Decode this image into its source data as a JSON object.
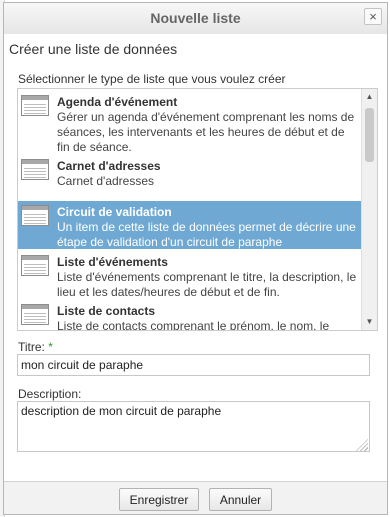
{
  "dialog": {
    "title": "Nouvelle liste",
    "close_label": "×"
  },
  "content": {
    "heading": "Créer une liste de données",
    "select_label": "Sélectionner le type de liste que vous voulez créer"
  },
  "list_types": [
    {
      "title": "Agenda d'événement",
      "description": "Gérer un agenda d'événement comprenant les noms de séances, les intervenants et les heures de début et de fin de séance.",
      "selected": false
    },
    {
      "title": "Carnet d'adresses",
      "description": "Carnet d'adresses",
      "selected": false
    },
    {
      "title": "Circuit de validation",
      "description": "Un item de cette liste de données permet de décrire une étape de validation d'un circuit de paraphe",
      "selected": true
    },
    {
      "title": "Liste d'événements",
      "description": "Liste d'événements comprenant le titre, la description, le lieu et les dates/heures de début et de fin.",
      "selected": false
    },
    {
      "title": "Liste de contacts",
      "description": "Liste de contacts comprenant le prénom, le nom, le",
      "selected": false
    }
  ],
  "form": {
    "title_label": "Titre:",
    "required_marker": "*",
    "title_value": "mon circuit de paraphe",
    "description_label": "Description:",
    "description_value": "description de mon circuit de paraphe"
  },
  "footer": {
    "save_label": "Enregistrer",
    "cancel_label": "Annuler"
  },
  "colors": {
    "selected_row": "#6fa9d3",
    "required": "#2a9a2a"
  },
  "icons": {
    "list_type": "list-type-icon",
    "close": "close-icon",
    "scroll_up": "scroll-up-icon",
    "scroll_down": "scroll-down-icon"
  }
}
